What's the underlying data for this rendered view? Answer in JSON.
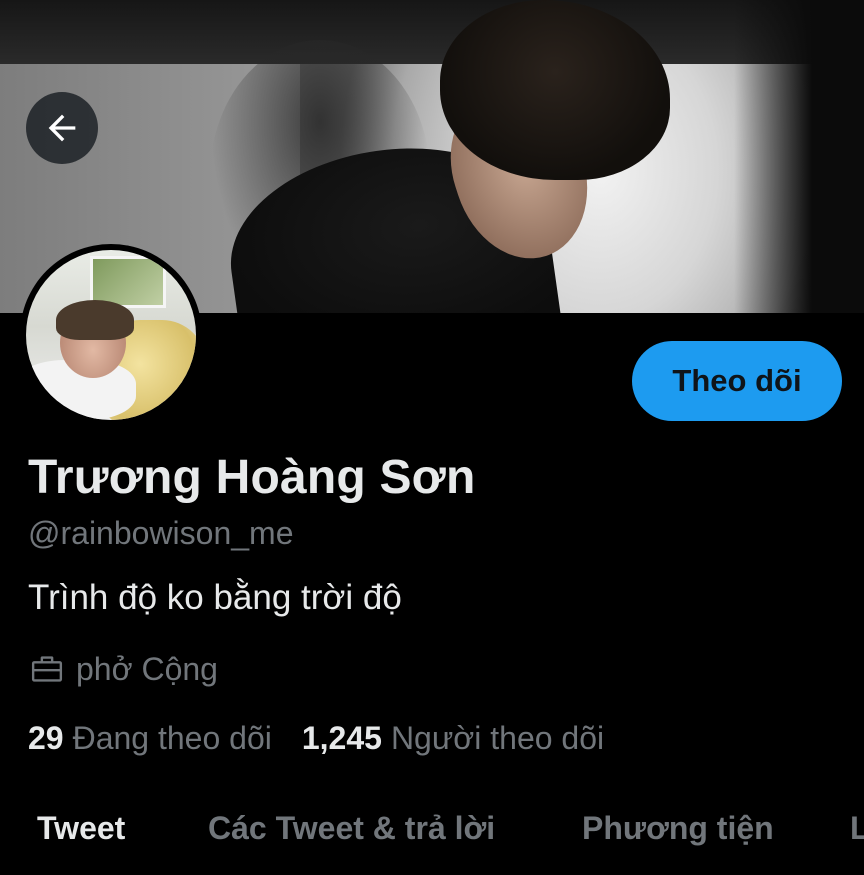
{
  "header": {
    "back_icon": "arrow-left-icon"
  },
  "profile": {
    "name": "Trương Hoàng Sơn",
    "handle": "@rainbowison_me",
    "bio": "Trình độ ko bằng trời độ",
    "work_icon": "briefcase-icon",
    "work": "phở Cộng",
    "follow_label": "Theo dõi",
    "following_count": "29",
    "following_label": "Đang theo dõi",
    "followers_count": "1,245",
    "followers_label": "Người theo dõi"
  },
  "tabs": [
    {
      "label": "Tweet",
      "active": true
    },
    {
      "label": "Các Tweet & trả lời",
      "active": false
    },
    {
      "label": "Phương tiện",
      "active": false
    },
    {
      "label": "L",
      "active": false
    }
  ],
  "colors": {
    "accent": "#1d9bf0",
    "background": "#000000",
    "text_primary": "#e7e9ea",
    "text_secondary": "#71767b"
  }
}
